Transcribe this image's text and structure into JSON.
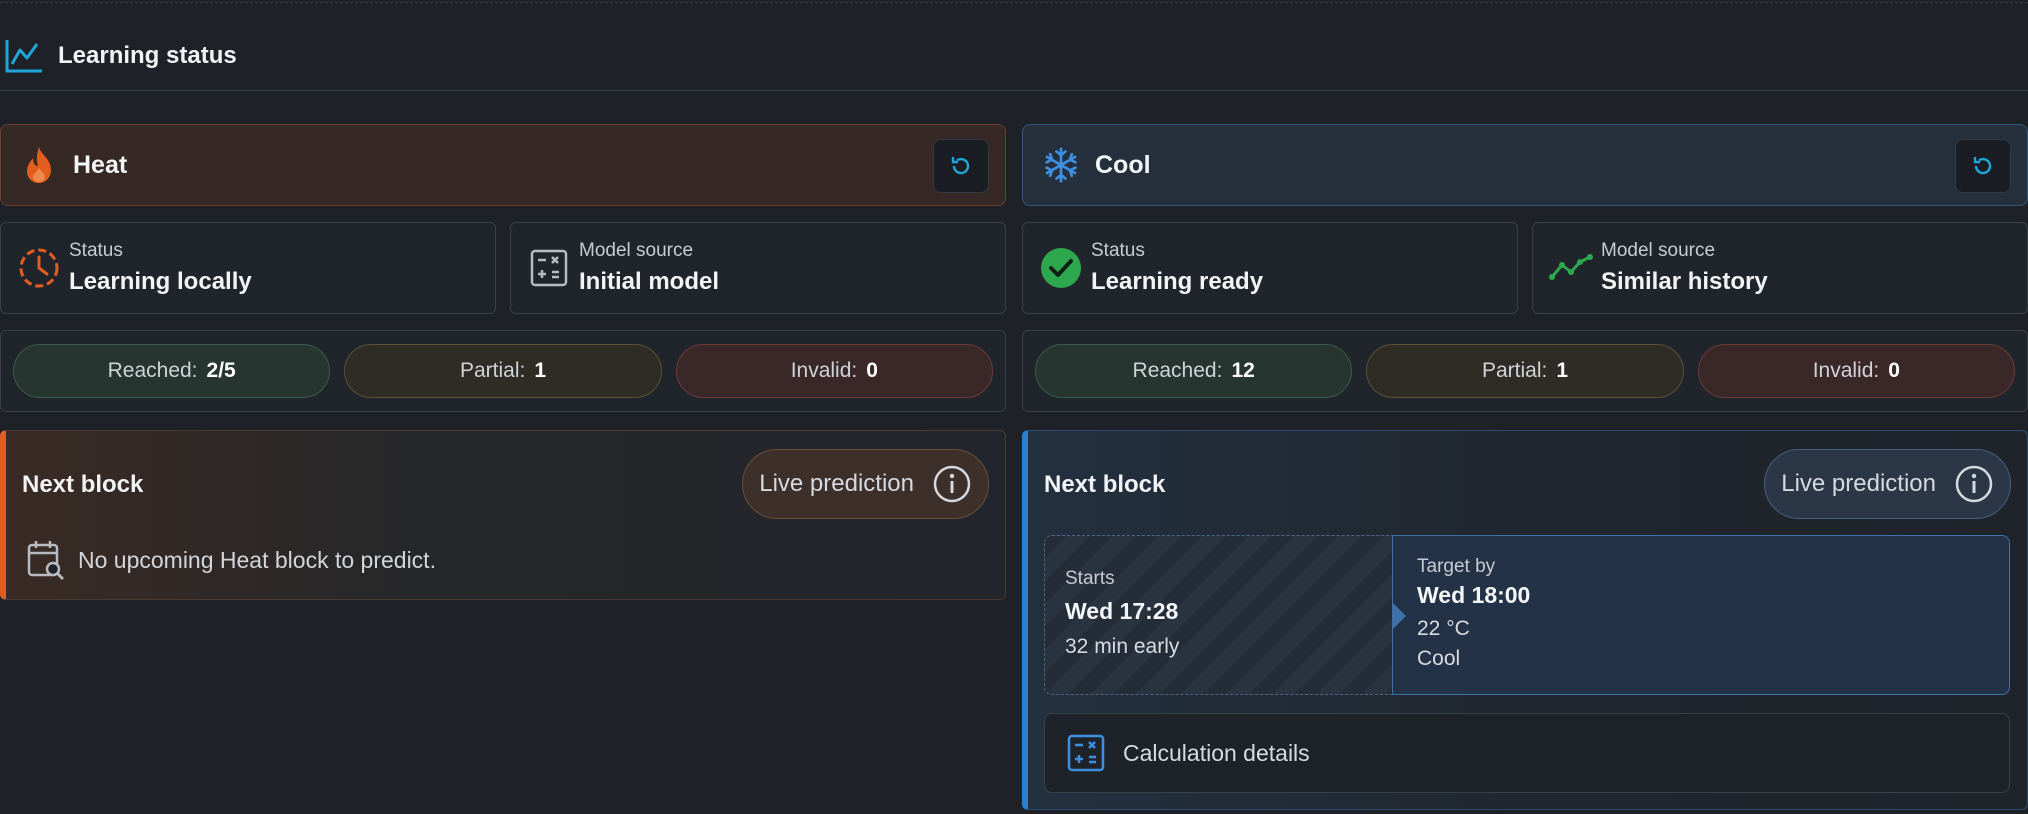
{
  "header": {
    "title": "Learning status",
    "icon": "chart-line-icon"
  },
  "colors": {
    "heat": "#e35d1f",
    "cool": "#2a7fd4",
    "ready": "#2ea84f",
    "info": "#1fa6d8"
  },
  "heat": {
    "label": "Heat",
    "icon": "fire-icon",
    "status": {
      "label": "Status",
      "value": "Learning locally",
      "icon": "clock-icon"
    },
    "source": {
      "label": "Model source",
      "value": "Initial model",
      "icon": "calculator-icon"
    },
    "counts": {
      "reached_label": "Reached:",
      "reached_value": "2/5",
      "partial_label": "Partial:",
      "partial_value": "1",
      "invalid_label": "Invalid:",
      "invalid_value": "0"
    },
    "next_block": {
      "title": "Next block",
      "live_label": "Live prediction",
      "empty_message": "No upcoming Heat block to predict."
    }
  },
  "cool": {
    "label": "Cool",
    "icon": "snowflake-icon",
    "status": {
      "label": "Status",
      "value": "Learning ready",
      "icon": "check-circle-icon"
    },
    "source": {
      "label": "Model source",
      "value": "Similar history",
      "icon": "trend-icon"
    },
    "counts": {
      "reached_label": "Reached:",
      "reached_value": "12",
      "partial_label": "Partial:",
      "partial_value": "1",
      "invalid_label": "Invalid:",
      "invalid_value": "0"
    },
    "next_block": {
      "title": "Next block",
      "live_label": "Live prediction",
      "starts_label": "Starts",
      "starts_value": "Wed 17:28",
      "starts_note": "32 min early",
      "target_label": "Target by",
      "target_value": "Wed 18:00",
      "target_temp": "22 °C",
      "target_mode": "Cool",
      "calc_label": "Calculation details"
    }
  }
}
